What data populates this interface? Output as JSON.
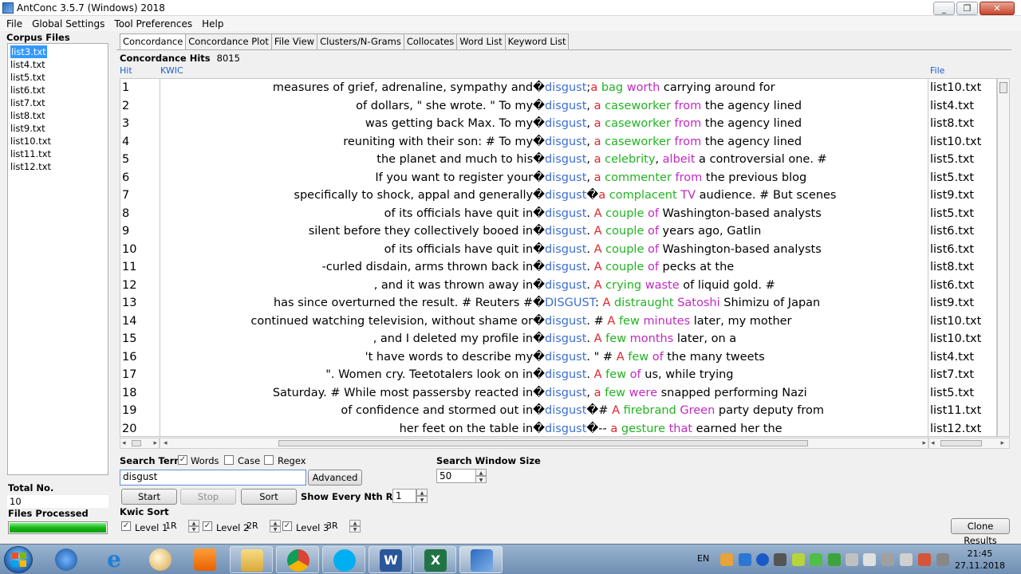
{
  "window": {
    "title": "AntConc 3.5.7 (Windows) 2018",
    "min": "_",
    "max": "❐",
    "close": "✕"
  },
  "menu": [
    "File",
    "Global Settings",
    "Tool Preferences",
    "Help"
  ],
  "left": {
    "corpus_label": "Corpus Files",
    "files": [
      "list3.txt",
      "list4.txt",
      "list5.txt",
      "list6.txt",
      "list7.txt",
      "list8.txt",
      "list9.txt",
      "list10.txt",
      "list11.txt",
      "list12.txt"
    ],
    "selected_file": "list3.txt",
    "total_label": "Total No.",
    "total_value": "10",
    "files_processed_label": "Files Processed",
    "progress": 1.0
  },
  "tabs": [
    "Concordance",
    "Concordance Plot",
    "File View",
    "Clusters/N-Grams",
    "Collocates",
    "Word List",
    "Keyword List"
  ],
  "active_tab": "Concordance",
  "concordance": {
    "hits_label": "Concordance Hits",
    "hits_count": "8015",
    "col_hit": "Hit",
    "col_kwic": "KWIC",
    "col_file": "File",
    "rows": [
      {
        "n": "1",
        "left": "measures of grief, adrenaline, sympathy and�",
        "kw": "disgust",
        "p": ";",
        "w1": "a",
        "s1": " ",
        "w2": "bag",
        "s2": " ",
        "w3": "worth",
        "rest": " carrying around for",
        "file": "list10.txt"
      },
      {
        "n": "2",
        "left": "of dollars, \" she wrote. \" To my�",
        "kw": "disgust",
        "p": ", ",
        "w1": "a",
        "s1": " ",
        "w2": "caseworker",
        "s2": " ",
        "w3": "from",
        "rest": " the agency lined",
        "file": "list4.txt"
      },
      {
        "n": "3",
        "left": "was getting back Max. To my�",
        "kw": "disgust",
        "p": ", ",
        "w1": "a",
        "s1": " ",
        "w2": "caseworker",
        "s2": " ",
        "w3": "from",
        "rest": " the agency lined",
        "file": "list8.txt"
      },
      {
        "n": "4",
        "left": "reuniting with their son: # To my�",
        "kw": "disgust",
        "p": ", ",
        "w1": "a",
        "s1": " ",
        "w2": "caseworker",
        "s2": " ",
        "w3": "from",
        "rest": " the agency lined",
        "file": "list10.txt"
      },
      {
        "n": "5",
        "left": "the planet and much to his�",
        "kw": "disgust",
        "p": ", ",
        "w1": "a",
        "s1": " ",
        "w2": "celebrity",
        "s2": ", ",
        "w3": "albeit",
        "rest": " a controversial one. #",
        "file": "list5.txt"
      },
      {
        "n": "6",
        "left": "If you want to register your�",
        "kw": "disgust",
        "p": ", ",
        "w1": "a",
        "s1": " ",
        "w2": "commenter",
        "s2": " ",
        "w3": "from",
        "rest": " the previous blog",
        "file": "list5.txt"
      },
      {
        "n": "7",
        "left": "specifically to shock, appal and generally�",
        "kw": "disgust",
        "p": "�",
        "w1": "a",
        "s1": " ",
        "w2": "complacent",
        "s2": " ",
        "w3": "TV",
        "rest": " audience. # But scenes",
        "file": "list9.txt"
      },
      {
        "n": "8",
        "left": "of its officials have quit in�",
        "kw": "disgust",
        "p": ". ",
        "w1": "A",
        "s1": " ",
        "w2": "couple",
        "s2": " ",
        "w3": "of",
        "rest": " Washington-based analysts",
        "file": "list5.txt"
      },
      {
        "n": "9",
        "left": "silent before they collectively booed in�",
        "kw": "disgust",
        "p": ". ",
        "w1": "A",
        "s1": " ",
        "w2": "couple",
        "s2": " ",
        "w3": "of",
        "rest": " years ago, Gatlin",
        "file": "list6.txt"
      },
      {
        "n": "10",
        "left": "of its officials have quit in�",
        "kw": "disgust",
        "p": ". ",
        "w1": "A",
        "s1": " ",
        "w2": "couple",
        "s2": " ",
        "w3": "of",
        "rest": " Washington-based analysts",
        "file": "list6.txt"
      },
      {
        "n": "11",
        "left": "-curled disdain, arms thrown back in�",
        "kw": "disgust",
        "p": ". ",
        "w1": "A",
        "s1": " ",
        "w2": "couple",
        "s2": " ",
        "w3": "of",
        "rest": " pecks at the",
        "file": "list8.txt"
      },
      {
        "n": "12",
        "left": ", and it was thrown away in�",
        "kw": "disgust",
        "p": ". ",
        "w1": "A",
        "s1": " ",
        "w2": "crying",
        "s2": " ",
        "w3": "waste",
        "rest": " of liquid gold. #",
        "file": "list6.txt"
      },
      {
        "n": "13",
        "left": "has since overturned the result. # Reuters #�",
        "kw": "DISGUST",
        "p": ": ",
        "w1": "A",
        "s1": " ",
        "w2": "distraught",
        "s2": " ",
        "w3": "Satoshi",
        "rest": " Shimizu of Japan",
        "file": "list9.txt"
      },
      {
        "n": "14",
        "left": "continued watching television, without shame or�",
        "kw": "disgust",
        "p": ". # ",
        "w1": "A",
        "s1": " ",
        "w2": "few",
        "s2": " ",
        "w3": "minutes",
        "rest": " later, my mother",
        "file": "list10.txt"
      },
      {
        "n": "15",
        "left": ", and I deleted my profile in�",
        "kw": "disgust",
        "p": ". ",
        "w1": "A",
        "s1": " ",
        "w2": "few",
        "s2": " ",
        "w3": "months",
        "rest": " later, on a",
        "file": "list10.txt"
      },
      {
        "n": "16",
        "left": "'t have words to describe my�",
        "kw": "disgust",
        "p": ". \" # ",
        "w1": "A",
        "s1": " ",
        "w2": "few",
        "s2": " ",
        "w3": "of",
        "rest": " the many tweets",
        "file": "list4.txt"
      },
      {
        "n": "17",
        "left": "\". Women cry. Teetotalers look on in�",
        "kw": "disgust",
        "p": ". ",
        "w1": "A",
        "s1": " ",
        "w2": "few",
        "s2": " ",
        "w3": "of",
        "rest": " us, while trying",
        "file": "list7.txt"
      },
      {
        "n": "18",
        "left": "Saturday. # While most passersby reacted in�",
        "kw": "disgust",
        "p": ", ",
        "w1": "a",
        "s1": " ",
        "w2": "few",
        "s2": " ",
        "w3": "were",
        "rest": " snapped performing Nazi",
        "file": "list5.txt"
      },
      {
        "n": "19",
        "left": "of confidence and stormed out in�",
        "kw": "disgust",
        "p": "�# ",
        "w1": "A",
        "s1": " ",
        "w2": "firebrand",
        "s2": " ",
        "w3": "Green",
        "rest": " party deputy from",
        "file": "list11.txt"
      },
      {
        "n": "20",
        "left": "her feet on the table in�",
        "kw": "disgust",
        "p": "�-- ",
        "w1": "a",
        "s1": " ",
        "w2": "gesture",
        "s2": " ",
        "w3": "that",
        "rest": " earned her the",
        "file": "list12.txt"
      }
    ]
  },
  "controls": {
    "search_term_label": "Search Term",
    "words_label": "Words",
    "words_checked": true,
    "case_label": "Case",
    "case_checked": false,
    "regex_label": "Regex",
    "regex_checked": false,
    "search_value": "disgust",
    "advanced_label": "Advanced",
    "search_window_label": "Search Window Size",
    "search_window_value": "50",
    "start_label": "Start",
    "stop_label": "Stop",
    "sort_label": "Sort",
    "nth_row_label": "Show Every Nth Row",
    "nth_row_value": "1",
    "kwic_sort_label": "Kwic Sort",
    "level1_label": "Level 1",
    "level1_value": "1R",
    "level2_label": "Level 2",
    "level2_value": "2R",
    "level3_label": "Level 3",
    "level3_value": "3R",
    "clone_label": "Clone Results"
  },
  "taskbar": {
    "lang": "EN",
    "time": "21:45",
    "date": "27.11.2018"
  },
  "colors": {
    "kw": "#3d6fd6",
    "w1": "#e0262c",
    "w2": "#22b322",
    "w3": "#c229c2"
  }
}
